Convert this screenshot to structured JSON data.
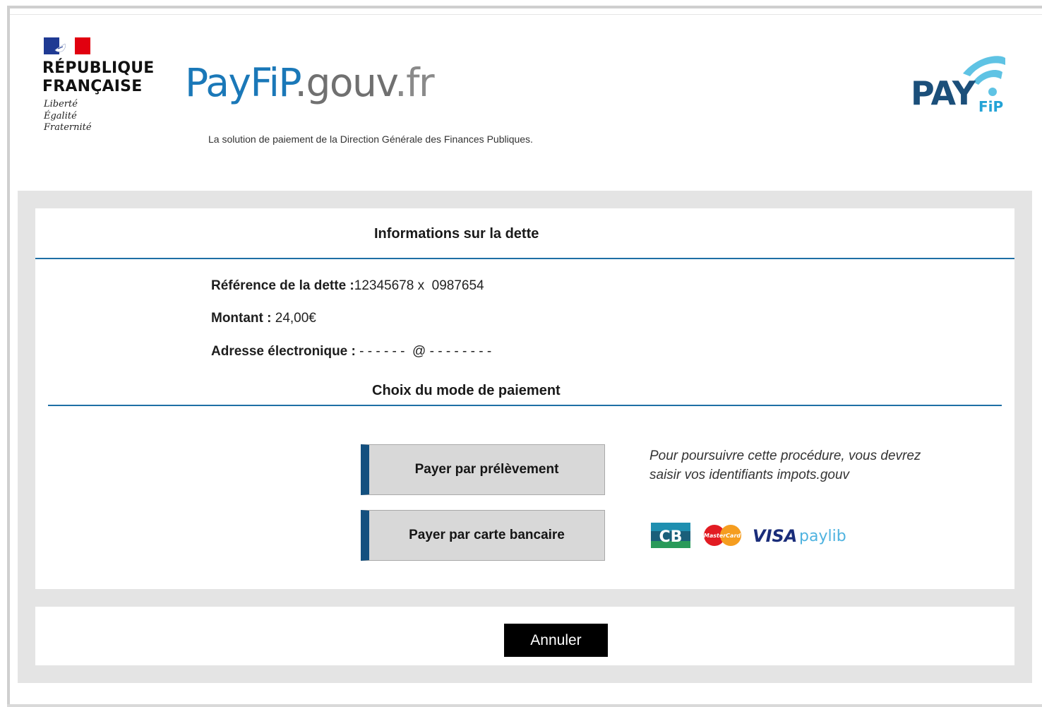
{
  "header": {
    "republique": {
      "title": "RÉPUBLIQUE\nFRANÇAISE",
      "motto": "Liberté\nÉgalité\nFraternité"
    },
    "site_title": {
      "pay": "PayFiP",
      "gouv": ".gouv",
      "fr": ".fr"
    },
    "tagline": "La solution de paiement de la Direction Générale des Finances Publiques.",
    "payfip_logo": {
      "word": "PAY",
      "sub": "FiP"
    }
  },
  "debt_info": {
    "title": "Informations sur la dette",
    "reference_label": "Référence de la dette :",
    "reference_value": "12345678 x  0987654",
    "amount_label": "Montant : ",
    "amount_value": "24,00€",
    "email_label": "Adresse électronique : ",
    "email_value": "- - - - - -  @ - - - - - - - -"
  },
  "payment": {
    "title": "Choix du mode de paiement",
    "direct_debit_label": "Payer par prélèvement",
    "card_label": "Payer par carte bancaire",
    "note": "Pour poursuivre cette procédure, vous devrez saisir vos identifiants impots.gouv",
    "card_logos": {
      "cb": "CB",
      "mastercard": "MasterCard",
      "visa": "VISA",
      "paylib": "paylib"
    }
  },
  "cancel_label": "Annuler",
  "colors": {
    "accent_blue": "#1e6fa5",
    "button_stripe": "#13507f",
    "button_bg": "#d8d8d8",
    "panel_grey": "#e4e4e4",
    "cancel_bg": "#000000"
  }
}
